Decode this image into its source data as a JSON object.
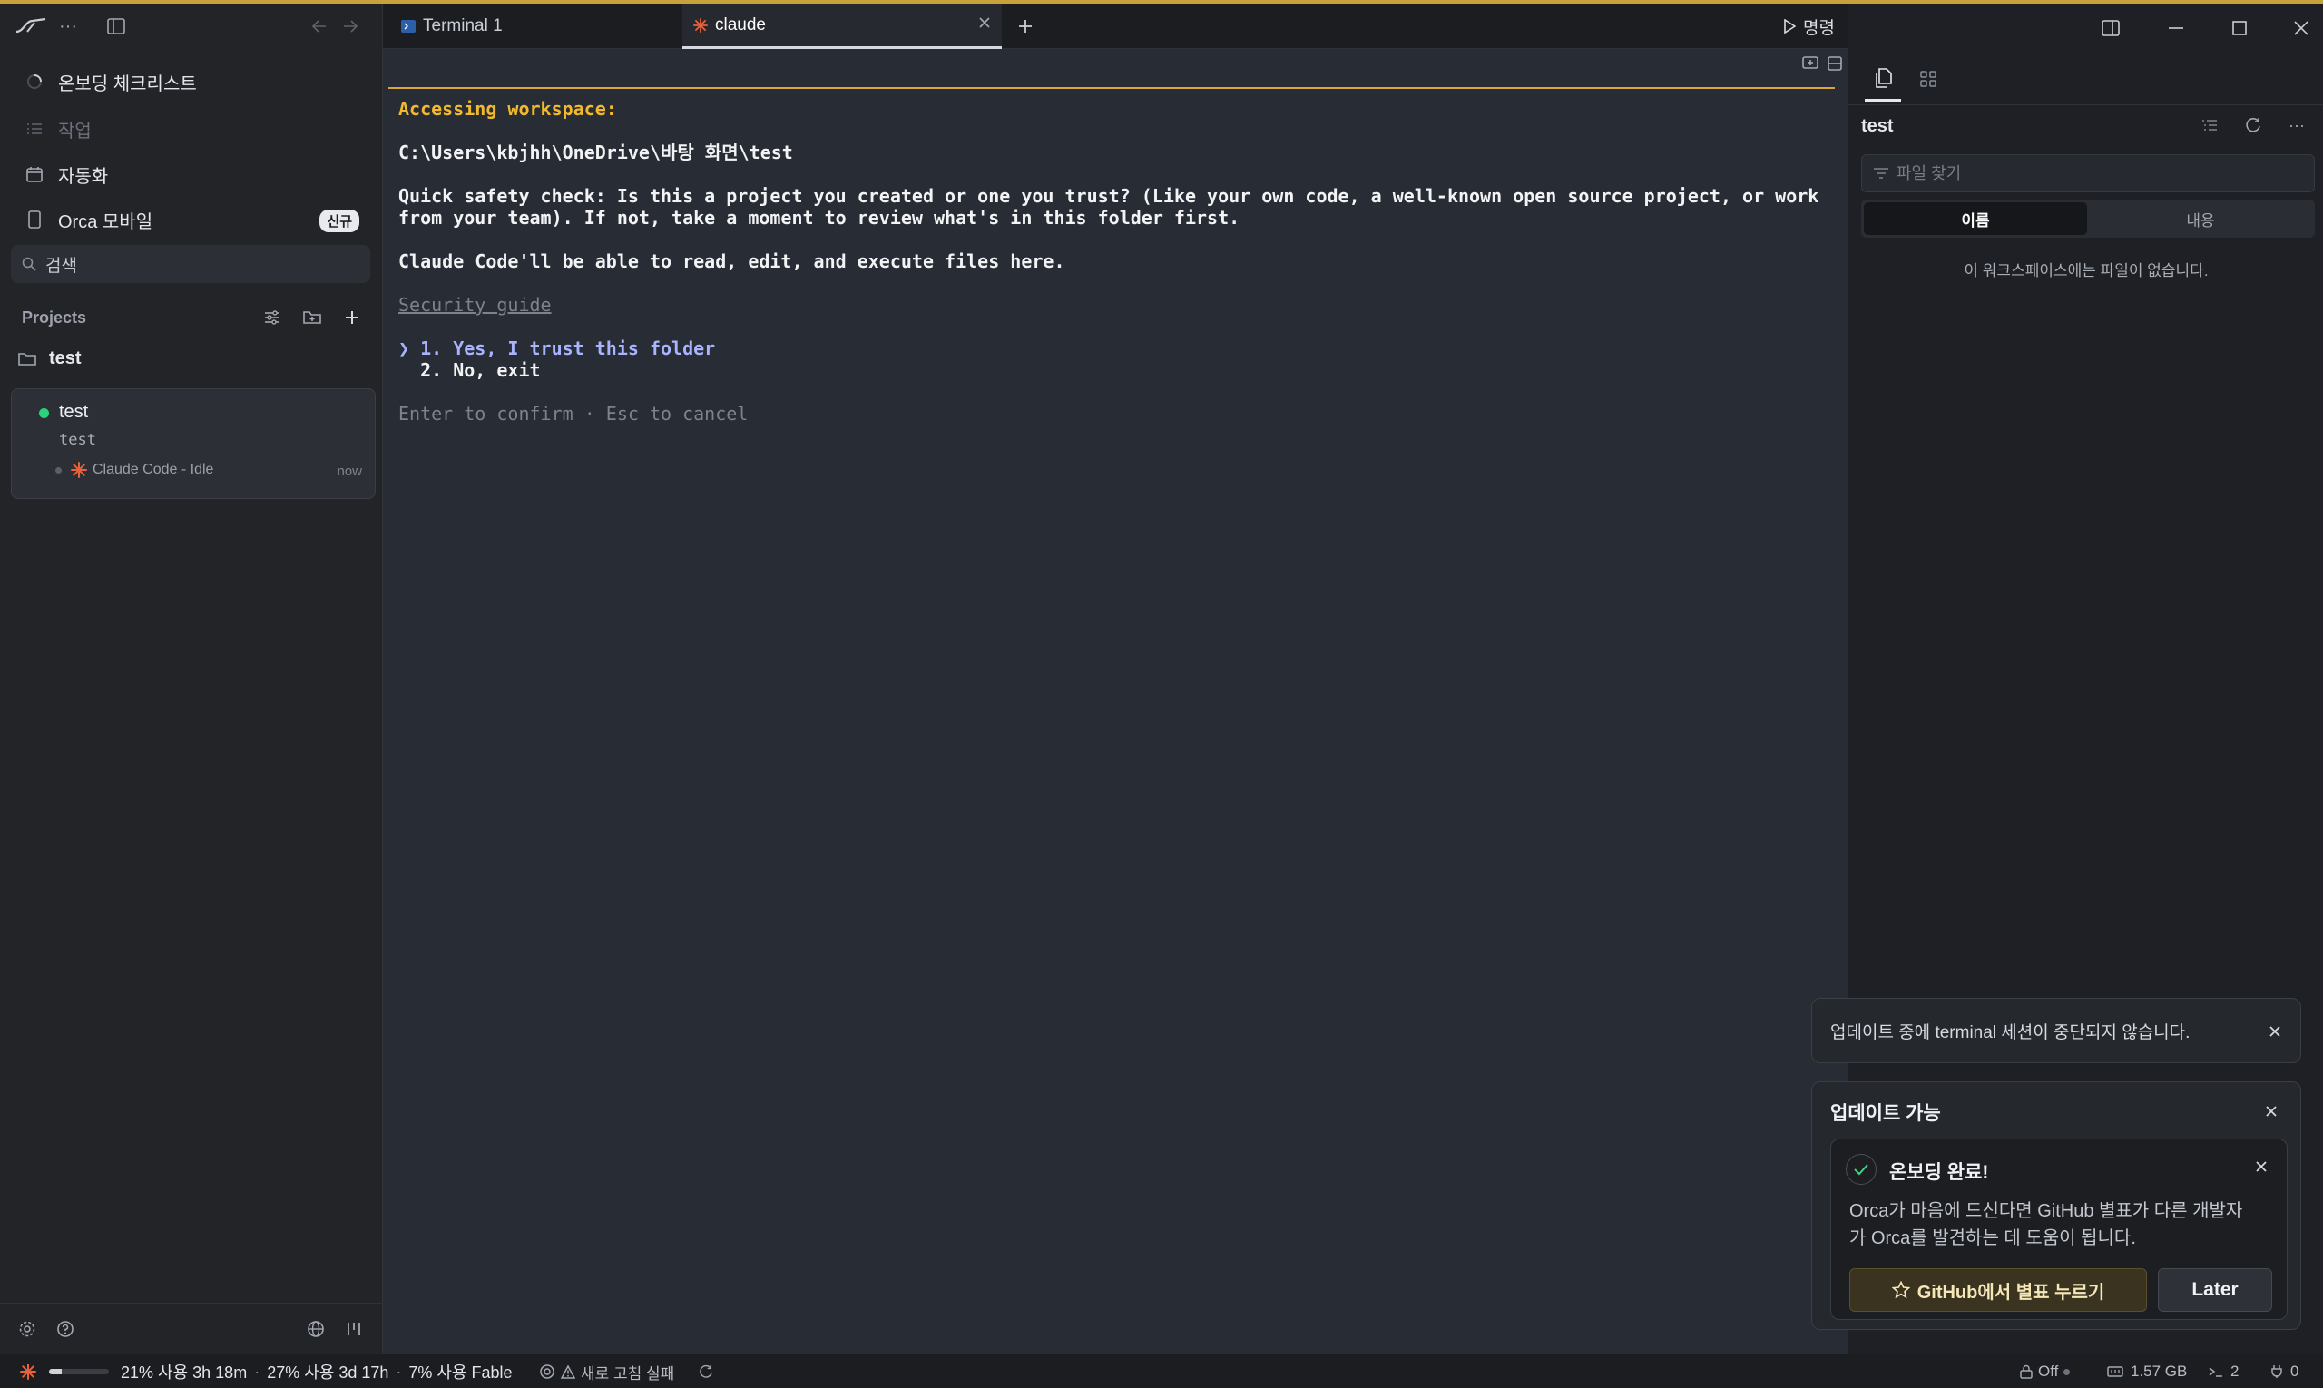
{
  "colors": {
    "accent": "#c7a23a",
    "terminal_bg": "#282c34",
    "claude_orange": "#e8623a",
    "idle_green": "#2bd27a"
  },
  "sidebar": {
    "nav": [
      {
        "label": "온보딩 체크리스트",
        "icon": "progress-ring-icon"
      },
      {
        "label": "작업",
        "icon": "list-icon"
      },
      {
        "label": "자동화",
        "icon": "calendar-icon"
      },
      {
        "label": "Orca 모바일",
        "icon": "phone-icon",
        "badge": "신규"
      }
    ],
    "search_label": "검색",
    "projects_header": "Projects",
    "project": {
      "name": "test"
    },
    "workspace": {
      "name": "test",
      "branch": "test",
      "agent": "Claude Code - Idle",
      "time": "now"
    }
  },
  "tabs": [
    {
      "label": "Terminal 1",
      "icon": "terminal-icon"
    },
    {
      "label": "claude",
      "icon": "claude-burst-icon",
      "active": true
    }
  ],
  "run_command_label": "명령",
  "terminal": {
    "heading": "Accessing workspace:",
    "path": "C:\\Users\\kbjhh\\OneDrive\\바탕 화면\\test",
    "safety_line1": "Quick safety check: Is this a project you created or one you trust? (Like your own code, a well-known open source project, or work",
    "safety_line2": "from your team). If not, take a moment to review what's in this folder first.",
    "capability": "Claude Code'll be able to read, edit, and execute files here.",
    "guide_link": "Security guide",
    "option1": "❯ 1. Yes, I trust this folder",
    "option2": "  2. No, exit",
    "hint": "Enter to confirm · Esc to cancel"
  },
  "right_panel": {
    "title": "test",
    "filter_placeholder": "파일 찾기",
    "seg_name": "이름",
    "seg_content": "내용",
    "empty_message": "이 워크스페이스에는 파일이 없습니다."
  },
  "toasts": {
    "update_notice": "업데이트 중에 terminal 세션이 중단되지 않습니다.",
    "update_title": "업데이트 가능",
    "onboarding_title": "온보딩 완료!",
    "onboarding_body": "Orca가 마음에 드신다면 GitHub 별표가 다른 개발자가 Orca를 발견하는 데 도움이 됩니다.",
    "star_button": "GitHub에서 별표 누르기",
    "later_button": "Later"
  },
  "status": {
    "usage_fraction": 0.21,
    "usage1": "21% 사용 3h 18m",
    "usage2": "27% 사용 3d 17h",
    "usage3": "7% 사용 Fable",
    "refresh_failed": "새로 고침 실패",
    "power": "Off",
    "memory": "1.57 GB",
    "terminals": "2",
    "ports": "0",
    "sep": "·"
  }
}
